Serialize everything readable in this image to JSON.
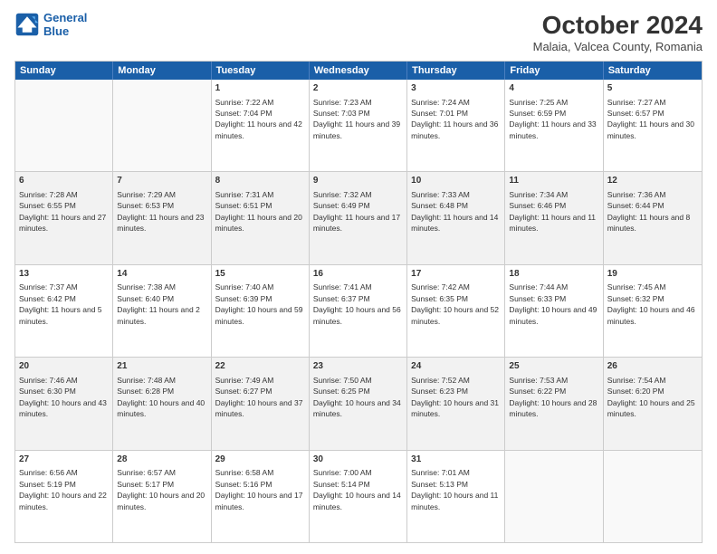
{
  "header": {
    "logo_line1": "General",
    "logo_line2": "Blue",
    "month": "October 2024",
    "location": "Malaia, Valcea County, Romania"
  },
  "days_of_week": [
    "Sunday",
    "Monday",
    "Tuesday",
    "Wednesday",
    "Thursday",
    "Friday",
    "Saturday"
  ],
  "rows": [
    [
      {
        "day": "",
        "text": ""
      },
      {
        "day": "",
        "text": ""
      },
      {
        "day": "1",
        "text": "Sunrise: 7:22 AM\nSunset: 7:04 PM\nDaylight: 11 hours and 42 minutes."
      },
      {
        "day": "2",
        "text": "Sunrise: 7:23 AM\nSunset: 7:03 PM\nDaylight: 11 hours and 39 minutes."
      },
      {
        "day": "3",
        "text": "Sunrise: 7:24 AM\nSunset: 7:01 PM\nDaylight: 11 hours and 36 minutes."
      },
      {
        "day": "4",
        "text": "Sunrise: 7:25 AM\nSunset: 6:59 PM\nDaylight: 11 hours and 33 minutes."
      },
      {
        "day": "5",
        "text": "Sunrise: 7:27 AM\nSunset: 6:57 PM\nDaylight: 11 hours and 30 minutes."
      }
    ],
    [
      {
        "day": "6",
        "text": "Sunrise: 7:28 AM\nSunset: 6:55 PM\nDaylight: 11 hours and 27 minutes."
      },
      {
        "day": "7",
        "text": "Sunrise: 7:29 AM\nSunset: 6:53 PM\nDaylight: 11 hours and 23 minutes."
      },
      {
        "day": "8",
        "text": "Sunrise: 7:31 AM\nSunset: 6:51 PM\nDaylight: 11 hours and 20 minutes."
      },
      {
        "day": "9",
        "text": "Sunrise: 7:32 AM\nSunset: 6:49 PM\nDaylight: 11 hours and 17 minutes."
      },
      {
        "day": "10",
        "text": "Sunrise: 7:33 AM\nSunset: 6:48 PM\nDaylight: 11 hours and 14 minutes."
      },
      {
        "day": "11",
        "text": "Sunrise: 7:34 AM\nSunset: 6:46 PM\nDaylight: 11 hours and 11 minutes."
      },
      {
        "day": "12",
        "text": "Sunrise: 7:36 AM\nSunset: 6:44 PM\nDaylight: 11 hours and 8 minutes."
      }
    ],
    [
      {
        "day": "13",
        "text": "Sunrise: 7:37 AM\nSunset: 6:42 PM\nDaylight: 11 hours and 5 minutes."
      },
      {
        "day": "14",
        "text": "Sunrise: 7:38 AM\nSunset: 6:40 PM\nDaylight: 11 hours and 2 minutes."
      },
      {
        "day": "15",
        "text": "Sunrise: 7:40 AM\nSunset: 6:39 PM\nDaylight: 10 hours and 59 minutes."
      },
      {
        "day": "16",
        "text": "Sunrise: 7:41 AM\nSunset: 6:37 PM\nDaylight: 10 hours and 56 minutes."
      },
      {
        "day": "17",
        "text": "Sunrise: 7:42 AM\nSunset: 6:35 PM\nDaylight: 10 hours and 52 minutes."
      },
      {
        "day": "18",
        "text": "Sunrise: 7:44 AM\nSunset: 6:33 PM\nDaylight: 10 hours and 49 minutes."
      },
      {
        "day": "19",
        "text": "Sunrise: 7:45 AM\nSunset: 6:32 PM\nDaylight: 10 hours and 46 minutes."
      }
    ],
    [
      {
        "day": "20",
        "text": "Sunrise: 7:46 AM\nSunset: 6:30 PM\nDaylight: 10 hours and 43 minutes."
      },
      {
        "day": "21",
        "text": "Sunrise: 7:48 AM\nSunset: 6:28 PM\nDaylight: 10 hours and 40 minutes."
      },
      {
        "day": "22",
        "text": "Sunrise: 7:49 AM\nSunset: 6:27 PM\nDaylight: 10 hours and 37 minutes."
      },
      {
        "day": "23",
        "text": "Sunrise: 7:50 AM\nSunset: 6:25 PM\nDaylight: 10 hours and 34 minutes."
      },
      {
        "day": "24",
        "text": "Sunrise: 7:52 AM\nSunset: 6:23 PM\nDaylight: 10 hours and 31 minutes."
      },
      {
        "day": "25",
        "text": "Sunrise: 7:53 AM\nSunset: 6:22 PM\nDaylight: 10 hours and 28 minutes."
      },
      {
        "day": "26",
        "text": "Sunrise: 7:54 AM\nSunset: 6:20 PM\nDaylight: 10 hours and 25 minutes."
      }
    ],
    [
      {
        "day": "27",
        "text": "Sunrise: 6:56 AM\nSunset: 5:19 PM\nDaylight: 10 hours and 22 minutes."
      },
      {
        "day": "28",
        "text": "Sunrise: 6:57 AM\nSunset: 5:17 PM\nDaylight: 10 hours and 20 minutes."
      },
      {
        "day": "29",
        "text": "Sunrise: 6:58 AM\nSunset: 5:16 PM\nDaylight: 10 hours and 17 minutes."
      },
      {
        "day": "30",
        "text": "Sunrise: 7:00 AM\nSunset: 5:14 PM\nDaylight: 10 hours and 14 minutes."
      },
      {
        "day": "31",
        "text": "Sunrise: 7:01 AM\nSunset: 5:13 PM\nDaylight: 10 hours and 11 minutes."
      },
      {
        "day": "",
        "text": ""
      },
      {
        "day": "",
        "text": ""
      }
    ]
  ]
}
